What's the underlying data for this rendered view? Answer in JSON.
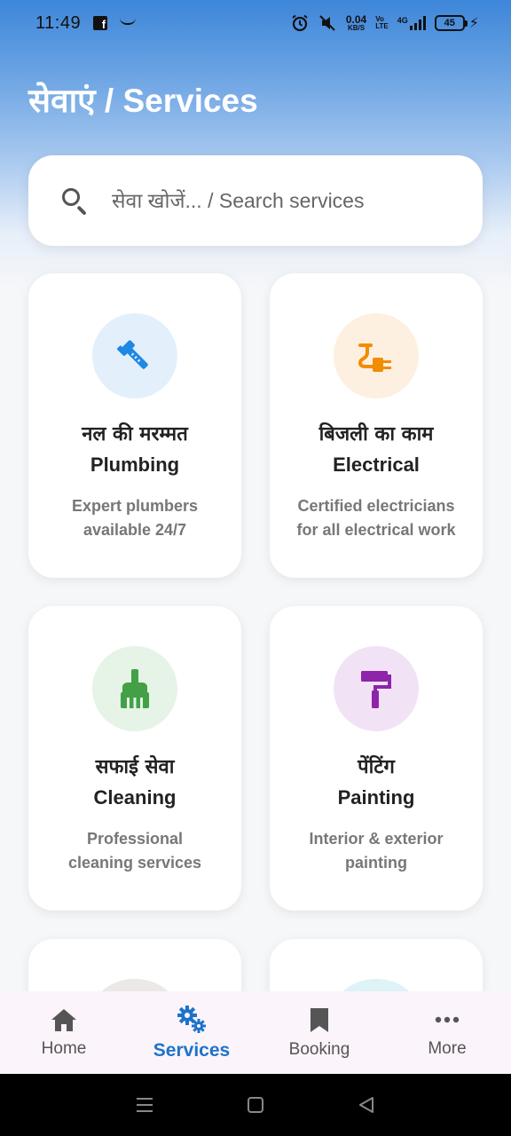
{
  "status_bar": {
    "time": "11:49",
    "net_speed": "0.04",
    "net_unit": "KB/S",
    "volte_top": "Vo",
    "volte_bottom": "LTE",
    "network": "4G",
    "battery": "45"
  },
  "header": {
    "title": "सेवाएं / Services"
  },
  "search": {
    "placeholder": "सेवा खोजें... / Search services"
  },
  "services": [
    {
      "hindi": "नल की मरम्मत",
      "english": "Plumbing",
      "description": "Expert plumbers available 24/7",
      "icon": "plumbing-wrench-icon",
      "icon_color": "#1e88e5",
      "bg_color": "#e3f0fc"
    },
    {
      "hindi": "बिजली का काम",
      "english": "Electrical",
      "description": "Certified electricians for all electrical work",
      "icon": "electrical-plug-icon",
      "icon_color": "#f28c00",
      "bg_color": "#fdf0e0"
    },
    {
      "hindi": "सफाई सेवा",
      "english": "Cleaning",
      "description": "Professional cleaning services",
      "icon": "cleaning-brush-icon",
      "icon_color": "#43a047",
      "bg_color": "#e6f3e7"
    },
    {
      "hindi": "पेंटिंग",
      "english": "Painting",
      "description": "Interior & exterior painting",
      "icon": "paint-roller-icon",
      "icon_color": "#8e24aa",
      "bg_color": "#f1e3f5"
    }
  ],
  "partial_cards": [
    {
      "bg_color": "#ece8e6"
    },
    {
      "bg_color": "#def3f6"
    }
  ],
  "bottom_nav": {
    "items": [
      {
        "label": "Home",
        "icon": "home-icon"
      },
      {
        "label": "Services",
        "icon": "settings-gears-icon",
        "active": true
      },
      {
        "label": "Booking",
        "icon": "bookmark-icon"
      },
      {
        "label": "More",
        "icon": "more-dots-icon"
      }
    ],
    "active_color": "#1e73c9"
  }
}
